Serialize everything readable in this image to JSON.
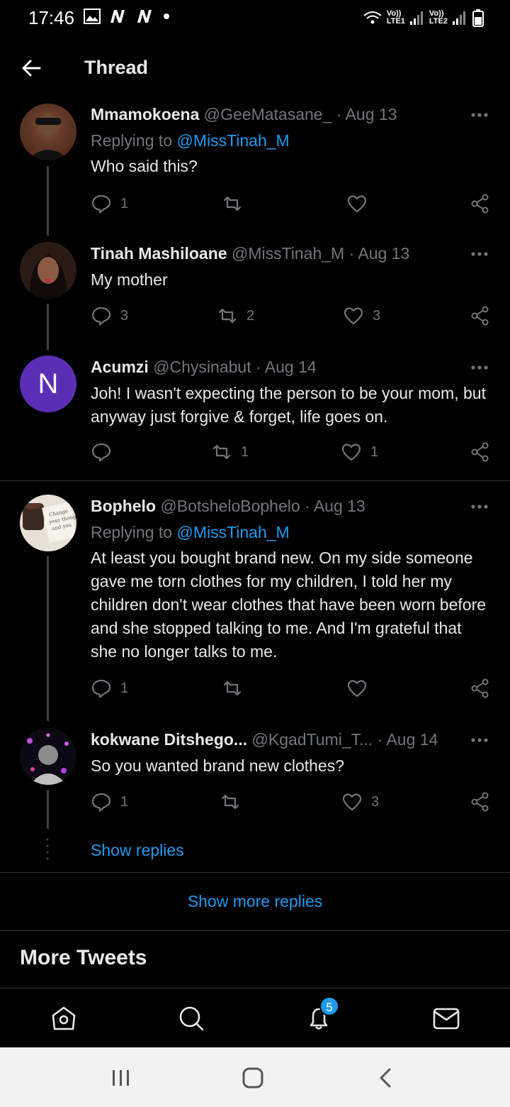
{
  "status_bar": {
    "time": "17:46",
    "sim1": "LTE1",
    "sim2": "LTE2",
    "volte": "Vo))"
  },
  "header": {
    "title": "Thread",
    "back_icon": "arrow-left-icon"
  },
  "tweets": [
    {
      "name": "Mmamokoena",
      "handle": "@GeeMatasane_",
      "date": "· Aug 13",
      "replying_prefix": "Replying to",
      "replying_to": "@MissTinah_M",
      "text": "Who said this?",
      "replies": "1",
      "retweets": "",
      "likes": ""
    },
    {
      "name": "Tinah Mashiloane",
      "handle": "@MissTinah_M",
      "date": "· Aug 13",
      "text": "My mother",
      "replies": "3",
      "retweets": "2",
      "likes": "3"
    },
    {
      "name": "Acumzi",
      "handle": "@Chysinabut",
      "date": "· Aug 14",
      "avatar_letter": "N",
      "text": "Joh! I wasn't expecting the person to be your mom, but anyway just forgive & forget, life goes on.",
      "replies": "",
      "retweets": "1",
      "likes": "1"
    },
    {
      "name": "Bophelo",
      "handle": "@BotsheloBophelo",
      "date": "· Aug 13",
      "replying_prefix": "Replying to",
      "replying_to": "@MissTinah_M",
      "text": "At least you bought brand new. On my side someone gave me torn clothes for my children, I told her my children don't wear clothes that have been worn before and she stopped talking to me. And I'm grateful that she no longer talks to me.",
      "replies": "1",
      "retweets": "",
      "likes": ""
    },
    {
      "name": "kokwane Ditshego...",
      "handle": "@KgadTumi_T...",
      "date": "· Aug 14",
      "text": "So you wanted brand new clothes?",
      "replies": "1",
      "retweets": "",
      "likes": "3"
    }
  ],
  "show_replies": "Show replies",
  "show_more_replies": "Show more replies",
  "more_tweets": "More Tweets",
  "bottom_nav": {
    "items": [
      "home-icon",
      "search-icon",
      "notifications-icon",
      "messages-icon"
    ],
    "notification_count": "5"
  },
  "colors": {
    "accent": "#1d9bf0",
    "background": "#000000",
    "muted": "#71767b",
    "avatar_letter_bg": "#5b2fb5"
  }
}
